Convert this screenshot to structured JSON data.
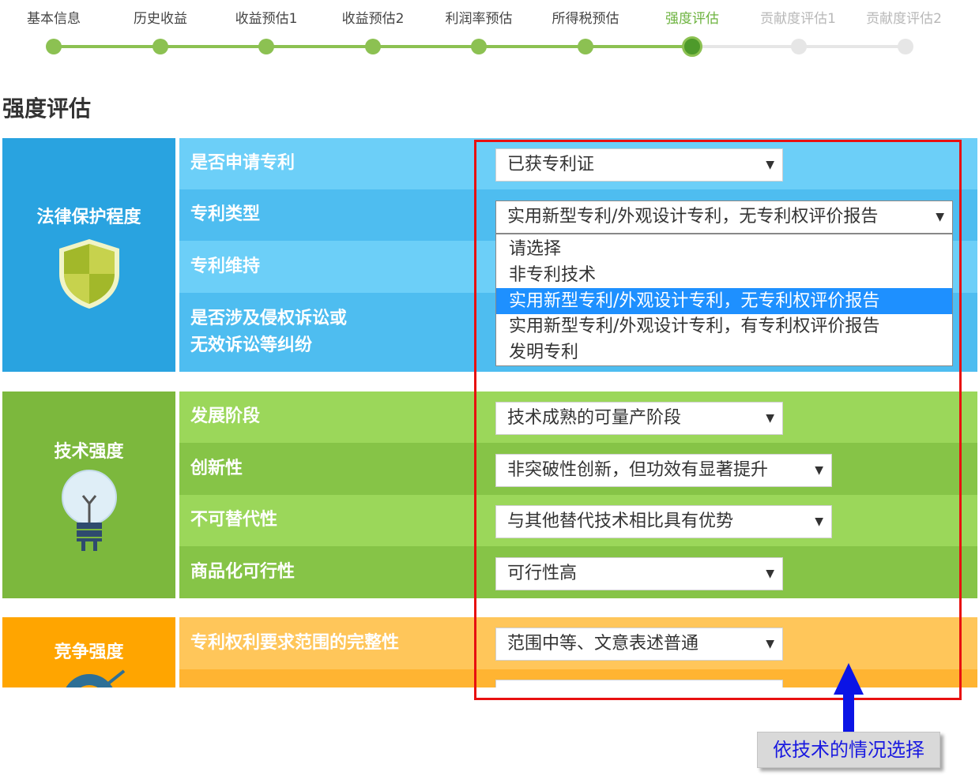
{
  "steps": [
    {
      "label": "基本信息",
      "state": "done"
    },
    {
      "label": "历史收益",
      "state": "done"
    },
    {
      "label": "收益预估1",
      "state": "done"
    },
    {
      "label": "收益预估2",
      "state": "done"
    },
    {
      "label": "利润率预估",
      "state": "done"
    },
    {
      "label": "所得税预估",
      "state": "done"
    },
    {
      "label": "强度评估",
      "state": "active"
    },
    {
      "label": "贡献度评估1",
      "state": "pending"
    },
    {
      "label": "贡献度评估2",
      "state": "pending"
    }
  ],
  "page_title": "强度评估",
  "sections": {
    "legal": {
      "title": "法律保护程度",
      "icon": "shield-icon",
      "color": "#29a3e0",
      "rows": [
        {
          "label": "是否申请专利",
          "value": "已获专利证"
        },
        {
          "label": "专利类型",
          "value": "实用新型专利/外观设计专利，无专利权评价报告"
        },
        {
          "label": "专利维持",
          "value": ""
        },
        {
          "label": "是否涉及侵权诉讼或",
          "label2": "无效诉讼等纠纷",
          "value": ""
        }
      ]
    },
    "tech": {
      "title": "技术强度",
      "icon": "lightbulb-icon",
      "color": "#7cb83d",
      "rows": [
        {
          "label": "发展阶段",
          "value": "技术成熟的可量产阶段"
        },
        {
          "label": "创新性",
          "value": "非突破性创新，但功效有显著提升"
        },
        {
          "label": "不可替代性",
          "value": "与其他替代技术相比具有优势"
        },
        {
          "label": "商品化可行性",
          "value": "可行性高"
        }
      ]
    },
    "competition": {
      "title": "竞争强度",
      "icon": "target-icon",
      "color": "#ffa500",
      "rows": [
        {
          "label": "专利权利要求范围的完整性",
          "value": "范围中等、文意表述普通"
        }
      ]
    }
  },
  "dropdown": {
    "options": [
      "请选择",
      "非专利技术",
      "实用新型专利/外观设计专利，无专利权评价报告",
      "实用新型专利/外观设计专利，有专利权评价报告",
      "发明专利"
    ],
    "selected_index": 2
  },
  "caret": "▼",
  "annotation": "依技术的情况选择",
  "colors": {
    "step_done": "#8cc152",
    "step_pending": "#e6e6e6",
    "highlight_box": "#e81010",
    "arrow": "#0b14e6",
    "dropdown_selected": "#1e90ff"
  }
}
